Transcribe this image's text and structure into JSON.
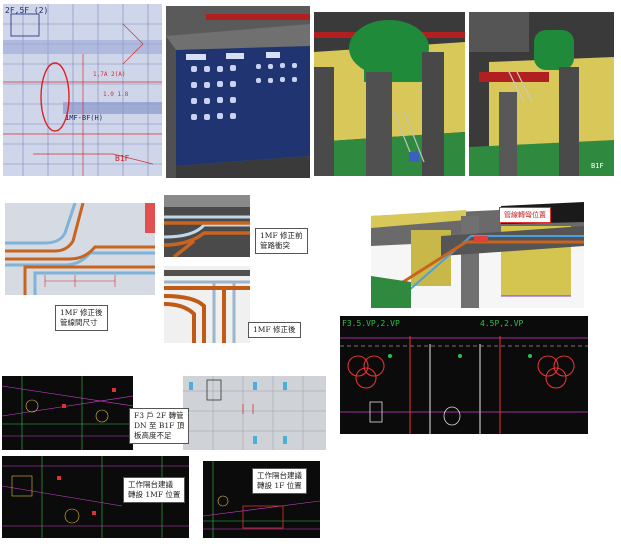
{
  "colors": {
    "cad_black": "#0b0b0b",
    "cad_blue_bg": "#cfd6ea",
    "pipe_orange": "#c8641e",
    "pipe_blue": "#7fb3d8",
    "panel_navy": "#1f3470",
    "duct_green": "#1f8a3a",
    "wall_yellow": "#d8c85a",
    "cad_red": "#e03030",
    "cad_green": "#2fc04a",
    "cad_magenta": "#d040d0"
  },
  "panels": {
    "p1": {
      "label_top": "2F,5F (2)",
      "label_b1f": "B1F",
      "label_mid": "1MF-BF(H)"
    },
    "p4": {
      "label_b1f": "B1F"
    },
    "p5": {
      "caption": [
        "1MF 修正後",
        "管線間尺寸"
      ]
    },
    "p6": {
      "caption": [
        "1MF 修正前",
        "管路衝突"
      ]
    },
    "p7": {
      "caption": [
        "1MF 修正後"
      ]
    },
    "p8": {
      "caption": [
        "管線轉彎位置"
      ]
    },
    "p9": {
      "label_left": "F3.5.VP,2.VP",
      "label_right": "4.5P,2.VP"
    },
    "p11": {
      "caption": [
        "F3 戶 2F 轉管",
        "DN 至 B1F 頂",
        "板高度不足"
      ]
    },
    "p12": {
      "caption": [
        "工作隔台建議",
        "轉設 1MF 位置"
      ]
    },
    "p13": {
      "caption": [
        "工作隔台建議",
        "轉設 1F 位置"
      ]
    }
  }
}
